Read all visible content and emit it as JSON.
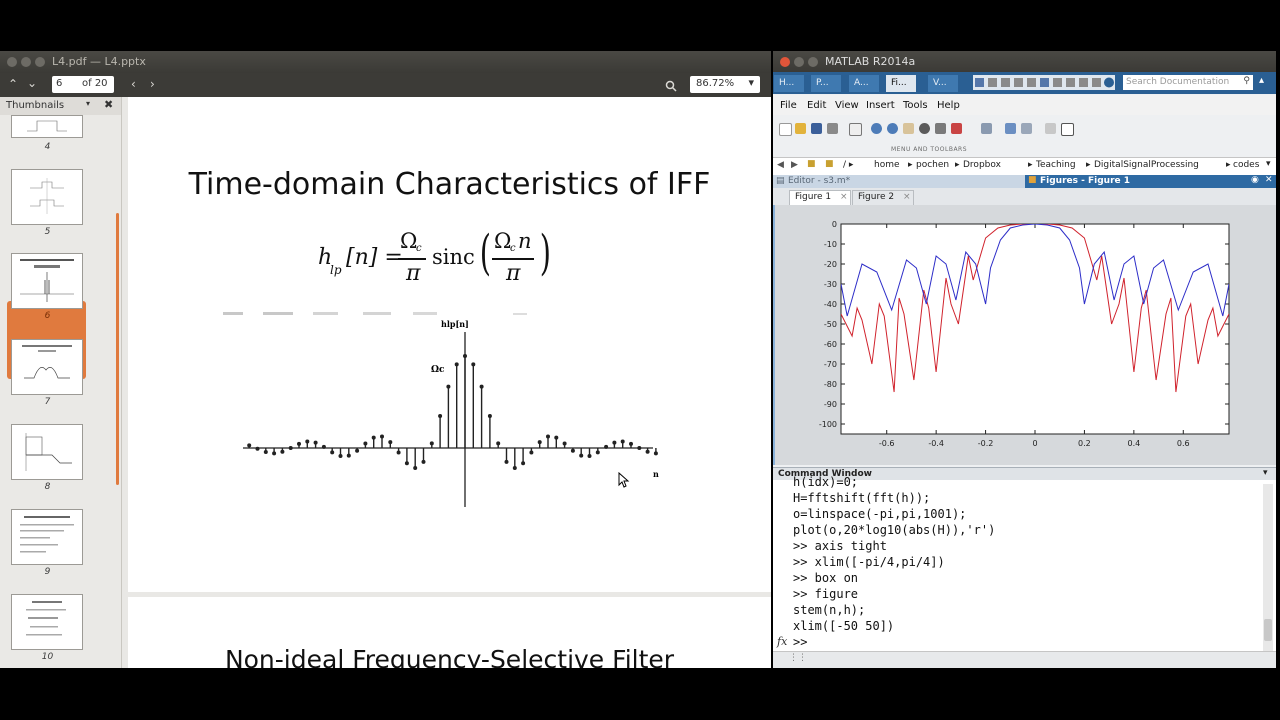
{
  "pdf_viewer": {
    "window_title": "L4.pdf — L4.pptx",
    "page_input": "6",
    "page_of": "of 20",
    "zoom": "86.72%",
    "sidebar_title": "Thumbnails",
    "thumbnails": [
      {
        "number": "4"
      },
      {
        "number": "5"
      },
      {
        "number": "6",
        "selected": true
      },
      {
        "number": "7"
      },
      {
        "number": "8"
      },
      {
        "number": "9"
      },
      {
        "number": "10"
      }
    ],
    "slide": {
      "title": "Time-domain Characteristics of IFF",
      "formula_lhs": "h",
      "formula_lhs_sub": "lp",
      "formula_arg": "[n] =",
      "formula_num": "Ω",
      "formula_num_sub": "c",
      "formula_den": "π",
      "formula_func": "sinc",
      "formula_inner_num": "Ω",
      "formula_inner_sub": "c",
      "formula_inner_var": "n",
      "formula_inner_den": "π",
      "stem_label_top": "hlp[n]",
      "stem_label_omega": "Ωc",
      "stem_label_n": "n"
    },
    "next_slide_title": "Non-ideal Frequency-Selective Filter"
  },
  "matlab": {
    "window_title": "MATLAB R2014a",
    "toolstrip_tabs": [
      "H...",
      "P...",
      "A...",
      "Fi...",
      "V..."
    ],
    "search_placeholder": "Search Documentation",
    "menus": [
      "File",
      "Edit",
      "View",
      "Insert",
      "Tools",
      "Help"
    ],
    "menu_toolbar_label": "MENU AND TOOLBARS",
    "address_path": [
      "home",
      "pochen",
      "Dropbox",
      "Teaching",
      "DigitalSignalProcessing",
      "codes"
    ],
    "editor_label": "Editor - s3.m*",
    "figures_label": "Figures - Figure 1",
    "figure_tabs": [
      "Figure 1",
      "Figure 2"
    ],
    "command_window_label": "Command Window",
    "command_lines": [
      "h(idx)=0;",
      "H=fftshift(fft(h));",
      "o=linspace(-pi,pi,1001);",
      "plot(o,20*log10(abs(H)),'r')",
      ">> axis tight",
      ">> xlim([-pi/4,pi/4])",
      ">> box on",
      ">> figure",
      "stem(n,h);",
      "xlim([-50 50])",
      ">>"
    ],
    "fx_label": "fx"
  },
  "chart_data": {
    "type": "line",
    "title": "",
    "xlabel": "",
    "ylabel": "",
    "xlim": [
      -0.785,
      0.785
    ],
    "ylim": [
      -105,
      0
    ],
    "xticks": [
      "-0.6",
      "-0.4",
      "-0.2",
      "0",
      "0.2",
      "0.4",
      "0.6"
    ],
    "yticks": [
      "0",
      "-10",
      "-20",
      "-30",
      "-40",
      "-50",
      "-60",
      "-70",
      "-80",
      "-90",
      "-100"
    ],
    "grid": false,
    "series": [
      {
        "color": "#d0222c",
        "x": [
          -0.785,
          -0.74,
          -0.72,
          -0.7,
          -0.66,
          -0.63,
          -0.61,
          -0.57,
          -0.55,
          -0.53,
          -0.49,
          -0.45,
          -0.43,
          -0.4,
          -0.36,
          -0.34,
          -0.31,
          -0.27,
          -0.25,
          -0.2,
          -0.15,
          -0.1,
          -0.05,
          0,
          0.05,
          0.1,
          0.15,
          0.2,
          0.25,
          0.27,
          0.31,
          0.34,
          0.36,
          0.4,
          0.43,
          0.45,
          0.49,
          0.53,
          0.55,
          0.57,
          0.61,
          0.63,
          0.66,
          0.7,
          0.72,
          0.74,
          0.785
        ],
        "values": [
          -45,
          -56,
          -42,
          -48,
          -70,
          -40,
          -46,
          -84,
          -37,
          -45,
          -78,
          -33,
          -42,
          -74,
          -27,
          -40,
          -50,
          -16,
          -28,
          -7,
          -2,
          -0.5,
          0,
          0,
          0,
          -0.5,
          -2,
          -7,
          -28,
          -16,
          -50,
          -40,
          -27,
          -74,
          -42,
          -33,
          -78,
          -45,
          -37,
          -84,
          -46,
          -40,
          -70,
          -48,
          -42,
          -56,
          -45
        ]
      },
      {
        "color": "#2d2dc8",
        "x": [
          -0.785,
          -0.76,
          -0.7,
          -0.64,
          -0.58,
          -0.52,
          -0.48,
          -0.44,
          -0.4,
          -0.36,
          -0.32,
          -0.28,
          -0.24,
          -0.2,
          -0.18,
          -0.14,
          -0.1,
          -0.05,
          0,
          0.05,
          0.1,
          0.14,
          0.18,
          0.2,
          0.24,
          0.28,
          0.32,
          0.36,
          0.4,
          0.44,
          0.48,
          0.52,
          0.58,
          0.64,
          0.7,
          0.76,
          0.785
        ],
        "values": [
          -30,
          -46,
          -20,
          -24,
          -43,
          -18,
          -22,
          -40,
          -16,
          -20,
          -38,
          -14,
          -20,
          -40,
          -22,
          -8,
          -2,
          -0.5,
          0,
          -0.5,
          -2,
          -8,
          -22,
          -40,
          -20,
          -14,
          -38,
          -20,
          -16,
          -40,
          -22,
          -18,
          -43,
          -24,
          -20,
          -46,
          -30
        ]
      }
    ]
  }
}
